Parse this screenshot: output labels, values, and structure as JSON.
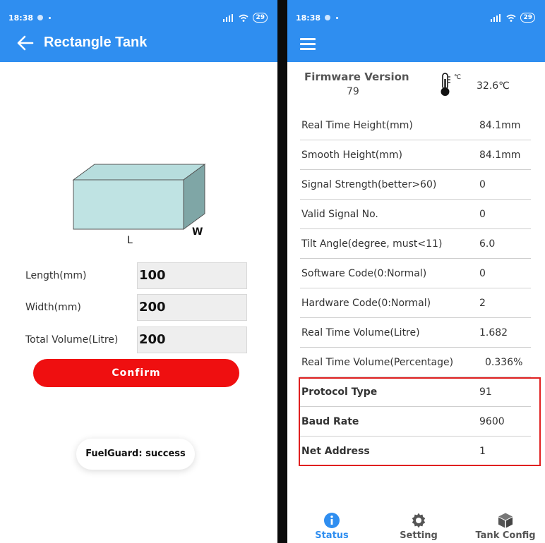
{
  "left": {
    "status_bar": {
      "time": "18:38",
      "signal": " ‵‖ ▾",
      "battery": "29"
    },
    "title": "Rectangle Tank",
    "diagram": {
      "label_l": "L",
      "label_w": "W"
    },
    "form": [
      {
        "label": "Length(mm)",
        "value": "100"
      },
      {
        "label": "Width(mm)",
        "value": "200"
      },
      {
        "label": "Total Volume(Litre)",
        "value": "200"
      }
    ],
    "confirm_label": "Confirm",
    "toast": "FuelGuard: success"
  },
  "right": {
    "status_bar": {
      "time": "18:38",
      "battery": "29"
    },
    "firmware": {
      "label": "Firmware Version",
      "value": "79"
    },
    "temperature": "32.6℃",
    "rows": [
      {
        "key": "Real Time Height(mm)",
        "value": "84.1mm"
      },
      {
        "key": "Smooth Height(mm)",
        "value": "84.1mm"
      },
      {
        "key": "Signal Strength(better>60)",
        "value": "0"
      },
      {
        "key": "Valid Signal No.",
        "value": "0"
      },
      {
        "key": "Tilt Angle(degree, must<11)",
        "value": "6.0"
      },
      {
        "key": "Software Code(0:Normal)",
        "value": "0"
      },
      {
        "key": "Hardware Code(0:Normal)",
        "value": "2"
      },
      {
        "key": "Real Time Volume(Litre)",
        "value": "1.682"
      },
      {
        "key": "Real Time Volume(Percentage)",
        "value": "0.336%"
      },
      {
        "key": "Protocol Type",
        "value": "91"
      },
      {
        "key": "Baud Rate",
        "value": "9600"
      },
      {
        "key": "Net Address",
        "value": "1"
      }
    ],
    "tabs": [
      {
        "label": "Status",
        "icon": "info-icon",
        "active": true
      },
      {
        "label": "Setting",
        "icon": "gear-icon",
        "active": false
      },
      {
        "label": "Tank Config",
        "icon": "cube-icon",
        "active": false
      }
    ]
  },
  "colors": {
    "accent": "#2f8ef0",
    "confirm": "#ef0f10",
    "highlight": "#e02020"
  }
}
